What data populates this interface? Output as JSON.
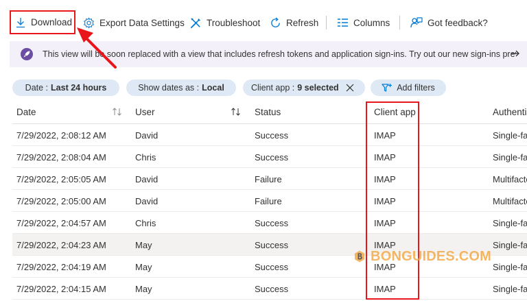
{
  "toolbar": {
    "download": "Download",
    "export": "Export Data Settings",
    "troubleshoot": "Troubleshoot",
    "refresh": "Refresh",
    "columns": "Columns",
    "feedback": "Got feedback?"
  },
  "banner": {
    "text": "This view will be soon replaced with a view that includes refresh tokens and application sign-ins. Try out our new sign-ins preview."
  },
  "filters": {
    "date_label": "Date :",
    "date_value": "Last 24 hours",
    "show_label": "Show dates as :",
    "show_value": "Local",
    "client_label": "Client app :",
    "client_value": "9 selected",
    "add": "Add filters"
  },
  "table": {
    "headers": {
      "date": "Date",
      "user": "User",
      "status": "Status",
      "client": "Client app",
      "auth": "Authentication requirement"
    },
    "rows": [
      {
        "date": "7/29/2022, 2:08:12 AM",
        "user": "David",
        "status": "Success",
        "client": "IMAP",
        "auth": "Single-factor authentication"
      },
      {
        "date": "7/29/2022, 2:08:04 AM",
        "user": "Chris",
        "status": "Success",
        "client": "IMAP",
        "auth": "Single-factor authentication"
      },
      {
        "date": "7/29/2022, 2:05:05 AM",
        "user": "David",
        "status": "Failure",
        "client": "IMAP",
        "auth": "Multifactor authentication"
      },
      {
        "date": "7/29/2022, 2:05:00 AM",
        "user": "David",
        "status": "Failure",
        "client": "IMAP",
        "auth": "Multifactor authentication"
      },
      {
        "date": "7/29/2022, 2:04:57 AM",
        "user": "Chris",
        "status": "Success",
        "client": "IMAP",
        "auth": "Single-factor authentication"
      },
      {
        "date": "7/29/2022, 2:04:23 AM",
        "user": "May",
        "status": "Success",
        "client": "IMAP",
        "auth": "Single-factor authentication"
      },
      {
        "date": "7/29/2022, 2:04:19 AM",
        "user": "May",
        "status": "Success",
        "client": "IMAP",
        "auth": "Single-factor authentication"
      },
      {
        "date": "7/29/2022, 2:04:15 AM",
        "user": "May",
        "status": "Success",
        "client": "IMAP",
        "auth": "Single-factor authentication"
      }
    ]
  },
  "watermark": {
    "text": "BONGUIDES.COM"
  },
  "colors": {
    "accent": "#0078d4",
    "highlight_red": "#e8161b",
    "pill_bg": "#dfe9f5",
    "banner_bg": "#f4f0f9",
    "watermark": "#f3a33b"
  }
}
